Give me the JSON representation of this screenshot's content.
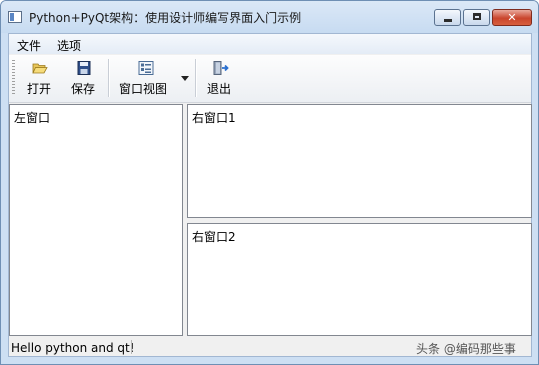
{
  "window": {
    "title": "Python+PyQt架构：使用设计师编写界面入门示例",
    "controls": {
      "minimize": "minimize",
      "maximize": "maximize",
      "close": "✕"
    }
  },
  "menu": {
    "items": [
      {
        "label": "文件"
      },
      {
        "label": "选项"
      }
    ]
  },
  "toolbar": {
    "buttons": [
      {
        "label": "打开",
        "icon": "folder-open-icon"
      },
      {
        "label": "保存",
        "icon": "floppy-disk-icon"
      },
      {
        "label": "窗口视图",
        "icon": "window-layout-icon",
        "has_dropdown": true
      },
      {
        "label": "退出",
        "icon": "exit-door-icon"
      }
    ]
  },
  "panes": {
    "left": "左窗口",
    "right_top": "右窗口1",
    "right_bottom": "右窗口2"
  },
  "status": {
    "message": "Hello python and qt!"
  },
  "watermark": "头条 @编码那些事"
}
